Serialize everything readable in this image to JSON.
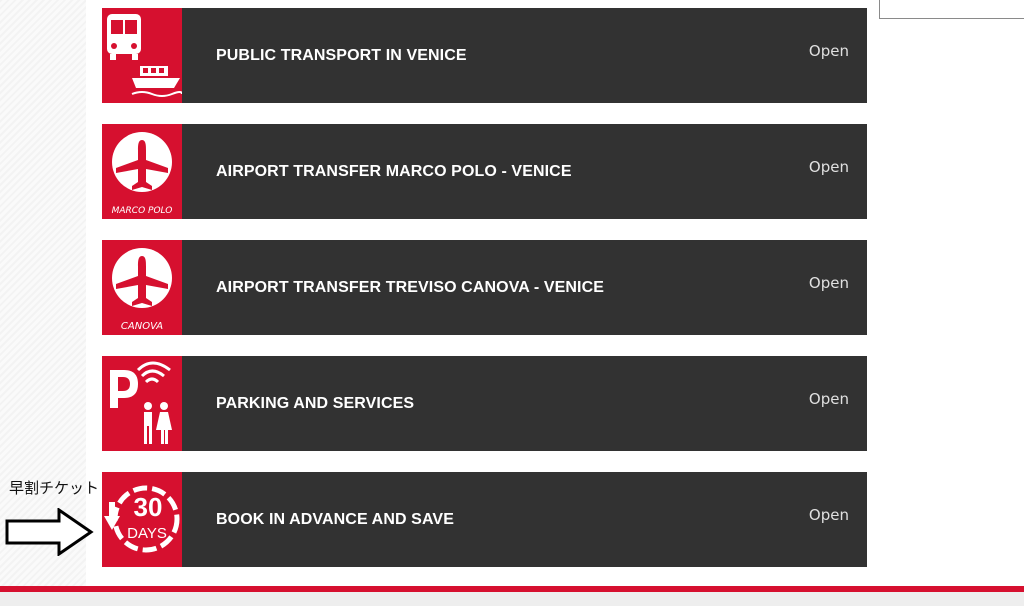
{
  "items": [
    {
      "title": "PUBLIC TRANSPORT IN VENICE",
      "action": "Open",
      "icon": "bus-boat-icon"
    },
    {
      "title": "AIRPORT TRANSFER MARCO POLO - VENICE",
      "action": "Open",
      "icon": "airplane-icon",
      "icon_caption": "MARCO POLO"
    },
    {
      "title": "AIRPORT TRANSFER TREVISO CANOVA - VENICE",
      "action": "Open",
      "icon": "airplane-icon",
      "icon_caption": "CANOVA"
    },
    {
      "title": "PARKING AND SERVICES",
      "action": "Open",
      "icon": "parking-wifi-toilet-icon"
    },
    {
      "title": "BOOK IN ADVANCE AND SAVE",
      "action": "Open",
      "icon": "30-days-icon",
      "icon_number": "30",
      "icon_unit": "DAYS"
    }
  ],
  "annotation": {
    "text": "早割チケット",
    "icon": "arrow-right-icon"
  },
  "colors": {
    "accent": "#d6102f",
    "card_bg": "#323232"
  }
}
